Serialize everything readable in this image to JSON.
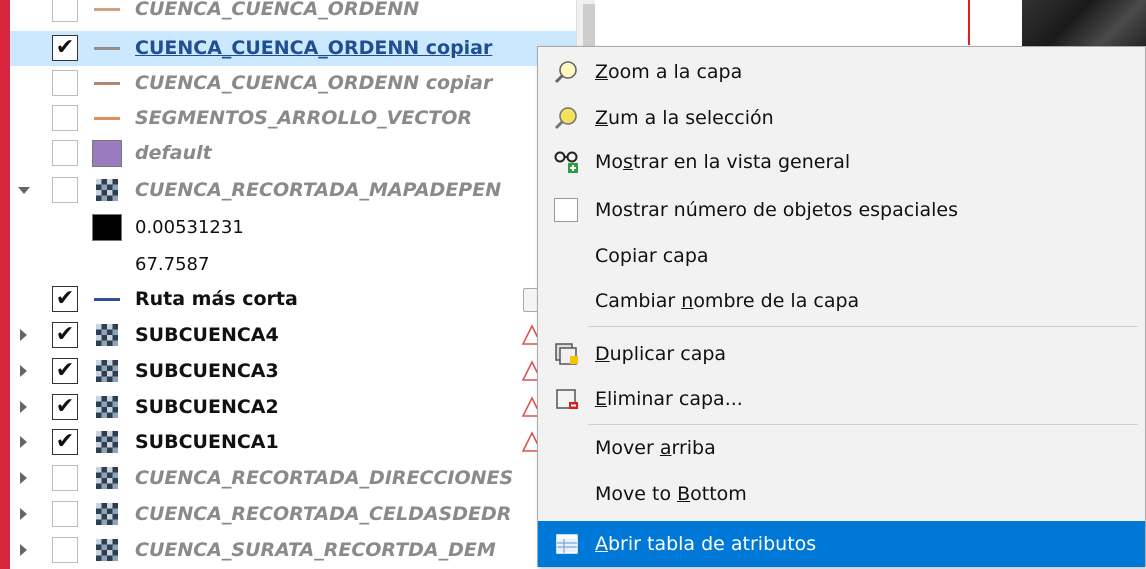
{
  "layers": [
    {
      "label": "CUENCA_CUENCA_ORDENN",
      "style": "inactive",
      "checked": false,
      "symbol": "line",
      "color": "#d0a080",
      "expander": "none"
    },
    {
      "label": "CUENCA_CUENCA_ORDENN copiar",
      "style": "sel",
      "checked": true,
      "symbol": "line",
      "color": "#909090",
      "expander": "none"
    },
    {
      "label": "CUENCA_CUENCA_ORDENN copiar",
      "style": "inactive",
      "checked": false,
      "symbol": "line",
      "color": "#b08870",
      "expander": "none"
    },
    {
      "label": "SEGMENTOS_ARROLLO_VECTOR",
      "style": "inactive",
      "checked": false,
      "symbol": "line",
      "color": "#e09060",
      "expander": "none"
    },
    {
      "label": "default",
      "style": "inactive",
      "checked": false,
      "symbol": "fill",
      "color": "#9b7bbf",
      "expander": "none"
    },
    {
      "label": "CUENCA_RECORTADA_MAPADEPEN",
      "style": "inactive",
      "checked": false,
      "symbol": "raster",
      "color": "",
      "expander": "expanded"
    },
    {
      "label": "0.00531231",
      "style": "plain",
      "checked": null,
      "symbol": "fill",
      "color": "#000000",
      "expander": "none"
    },
    {
      "label": "67.7587",
      "style": "plain",
      "checked": null,
      "symbol": "none",
      "color": "",
      "expander": "none"
    },
    {
      "label": "Ruta más corta",
      "style": "active",
      "checked": true,
      "symbol": "line",
      "color": "#2f4f9f",
      "expander": "none"
    },
    {
      "label": "SUBCUENCA4",
      "style": "active",
      "checked": true,
      "symbol": "raster",
      "color": "",
      "expander": "collapsed"
    },
    {
      "label": "SUBCUENCA3",
      "style": "active",
      "checked": true,
      "symbol": "raster",
      "color": "",
      "expander": "collapsed"
    },
    {
      "label": "SUBCUENCA2",
      "style": "active",
      "checked": true,
      "symbol": "raster",
      "color": "",
      "expander": "collapsed"
    },
    {
      "label": "SUBCUENCA1",
      "style": "active",
      "checked": true,
      "symbol": "raster",
      "color": "",
      "expander": "collapsed"
    },
    {
      "label": "CUENCA_RECORTADA_DIRECCIONES",
      "style": "inactive",
      "checked": false,
      "symbol": "raster",
      "color": "",
      "expander": "collapsed"
    },
    {
      "label": "CUENCA_RECORTADA_CELDASDEDR",
      "style": "inactive",
      "checked": false,
      "symbol": "raster",
      "color": "",
      "expander": "collapsed"
    },
    {
      "label": "CUENCA_SURATA_RECORTDA_DEM",
      "style": "inactive",
      "checked": false,
      "symbol": "raster",
      "color": "",
      "expander": "collapsed"
    }
  ],
  "menu": {
    "zoom_layer": {
      "pre": "",
      "key": "Z",
      "post": "oom a la capa"
    },
    "zoom_selection": {
      "pre": "",
      "key": "Z",
      "post": "um a la selección"
    },
    "show_overview": {
      "pre": "Mo",
      "key": "s",
      "post": "trar en la vista general"
    },
    "show_feature_count": "Mostrar número de objetos espaciales",
    "copy_layer": "Copiar capa",
    "rename_layer": {
      "pre": "Cambiar ",
      "key": "n",
      "post": "ombre de la capa"
    },
    "duplicate_layer": {
      "pre": "",
      "key": "D",
      "post": "uplicar capa"
    },
    "remove_layer": {
      "pre": "",
      "key": "E",
      "post": "liminar capa..."
    },
    "move_up": {
      "pre": "Mover ",
      "key": "a",
      "post": "rriba"
    },
    "move_bottom": {
      "pre": "Move to ",
      "key": "B",
      "post": "ottom"
    },
    "open_attribute_table": {
      "pre": "",
      "key": "A",
      "post": "brir tabla de atributos"
    }
  },
  "colors": {
    "highlight": "#0078d7",
    "selection_row": "#cce8ff",
    "left_accent": "#d7263d"
  }
}
